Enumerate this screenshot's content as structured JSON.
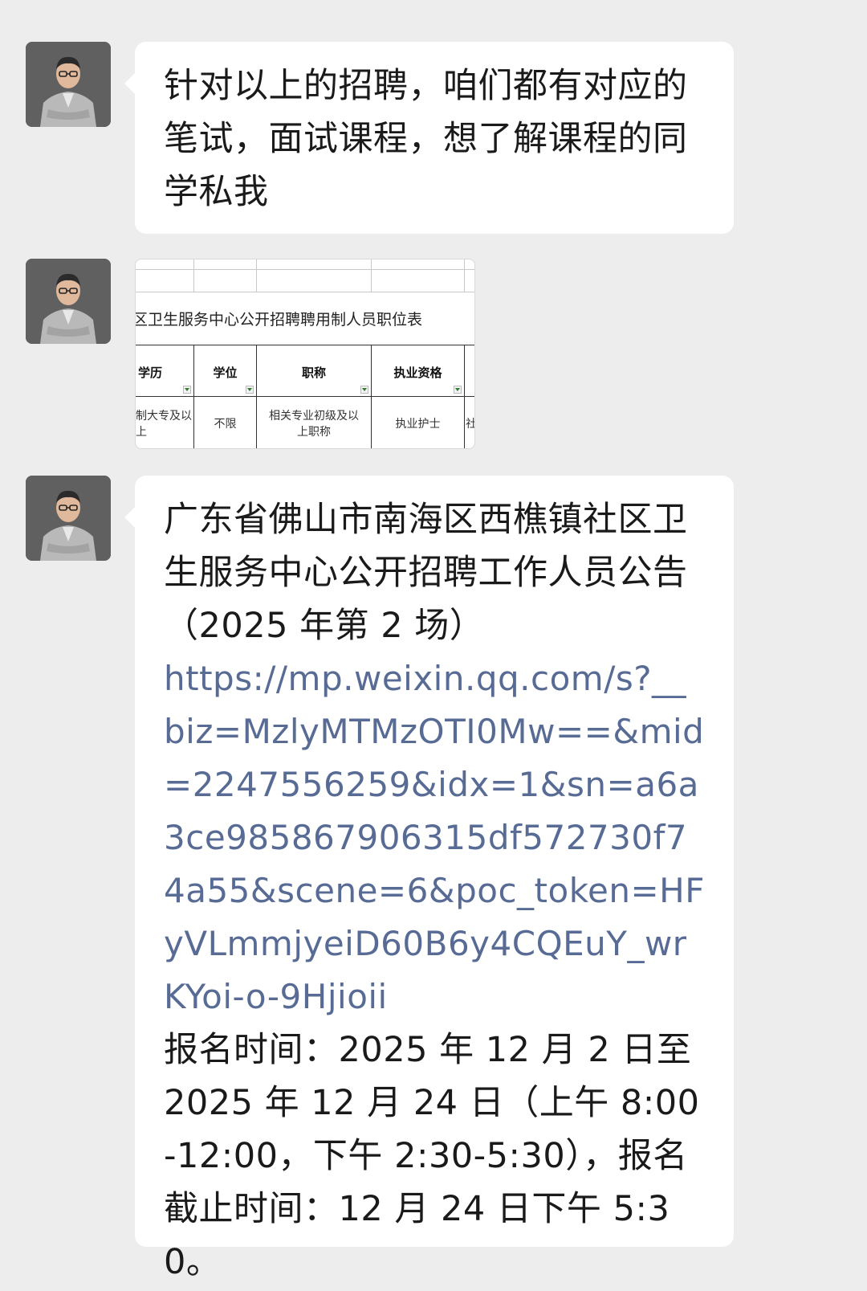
{
  "messages": [
    {
      "type": "text",
      "text": "针对以上的招聘，咱们都有对应的笔试，面试课程，想了解课程的同学私我"
    },
    {
      "type": "image",
      "table": {
        "title": "区卫生服务中心公开招聘聘用制人员职位表",
        "headers": [
          "学历",
          "学位",
          "职称",
          "执业资格"
        ],
        "row": [
          "制大专及以上",
          "不限",
          "相关专业初级及以上职称",
          "执业护士",
          "社"
        ]
      }
    },
    {
      "type": "text",
      "text": "广东省佛山市南海区西樵镇社区卫生服务中心公开招聘工作人员公告（2025 年第 2 场）",
      "link": "https://mp.weixin.qq.com/s?__biz=MzlyMTMzOTI0Mw==&mid=2247556259&idx=1&sn=a6a3ce985867906315df572730f74a55&scene=6&poc_token=HFyVLmmjyeiD60B6y4CQEuY_wrKYoi-o-9Hjioii",
      "after": "报名时间：2025 年 12 月 2 日至 2025 年 12 月 24 日（上午 8:00-12:00，下午 2:30-5:30），报名截止时间：12 月 24 日下午 5:30。"
    }
  ],
  "colors": {
    "background": "#ededed",
    "bubble": "#ffffff",
    "link": "#576b95",
    "text": "#1a1a1a"
  },
  "icons": {
    "avatar": "user-avatar-photo",
    "filter": "dropdown-filter-icon"
  }
}
